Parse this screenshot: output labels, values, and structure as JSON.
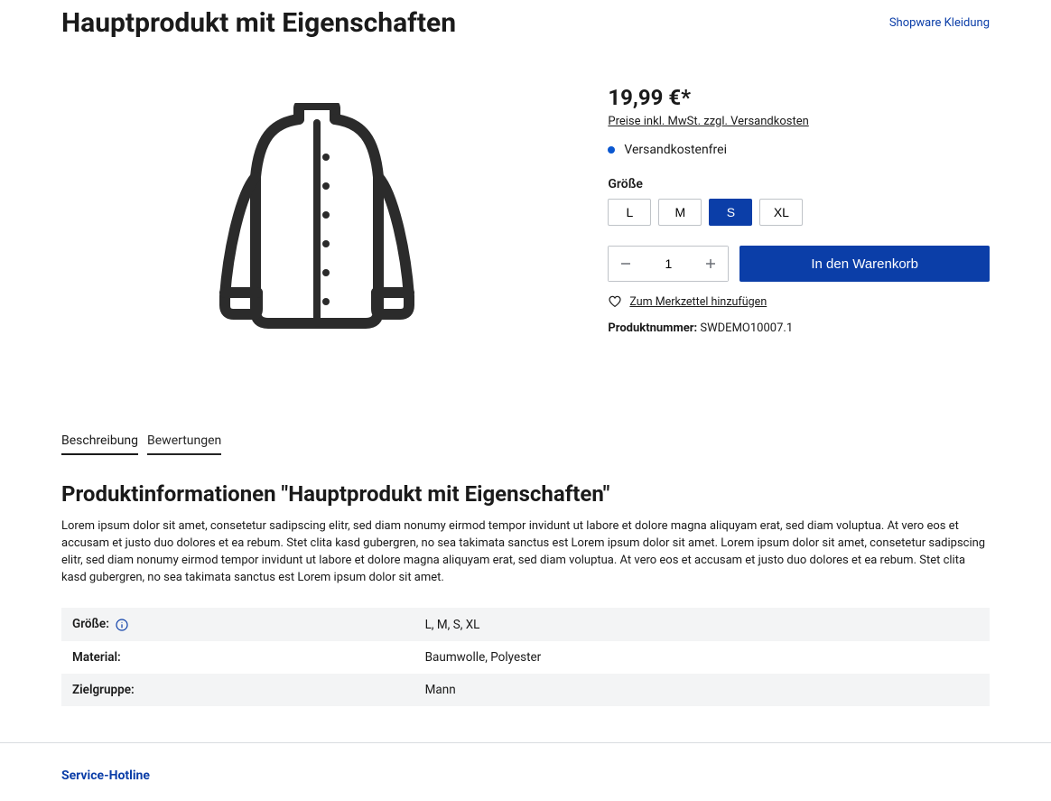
{
  "header": {
    "title": "Hauptprodukt mit Eigenschaften",
    "brand_link": "Shopware Kleidung"
  },
  "price": {
    "value": "19,99 €*",
    "tax_note": "Preise inkl. MwSt. zzgl. Versandkosten",
    "shipping_free": "Versandkostenfrei"
  },
  "variants": {
    "label": "Größe",
    "options": [
      "L",
      "M",
      "S",
      "XL"
    ],
    "selected": "S"
  },
  "quantity": {
    "value": "1"
  },
  "actions": {
    "add_to_cart": "In den Warenkorb",
    "wishlist": "Zum Merkzettel hinzufügen"
  },
  "product_number": {
    "label": "Produktnummer:",
    "value": "SWDEMO10007.1"
  },
  "tabs": {
    "description": "Beschreibung",
    "reviews": "Bewertungen"
  },
  "info": {
    "heading": "Produktinformationen \"Hauptprodukt mit Eigenschaften\"",
    "text": "Lorem ipsum dolor sit amet, consetetur sadipscing elitr, sed diam nonumy eirmod tempor invidunt ut labore et dolore magna aliquyam erat, sed diam voluptua. At vero eos et accusam et justo duo dolores et ea rebum. Stet clita kasd gubergren, no sea takimata sanctus est Lorem ipsum dolor sit amet. Lorem ipsum dolor sit amet, consetetur sadipscing elitr, sed diam nonumy eirmod tempor invidunt ut labore et dolore magna aliquyam erat, sed diam voluptua. At vero eos et accusam et justo duo dolores et ea rebum. Stet clita kasd gubergren, no sea takimata sanctus est Lorem ipsum dolor sit amet."
  },
  "properties": [
    {
      "label": "Größe:",
      "value": "L, M, S, XL",
      "info_icon": true
    },
    {
      "label": "Material:",
      "value": "Baumwolle, Polyester",
      "info_icon": false
    },
    {
      "label": "Zielgruppe:",
      "value": "Mann",
      "info_icon": false
    }
  ],
  "footer": {
    "hotline": "Service-Hotline"
  }
}
